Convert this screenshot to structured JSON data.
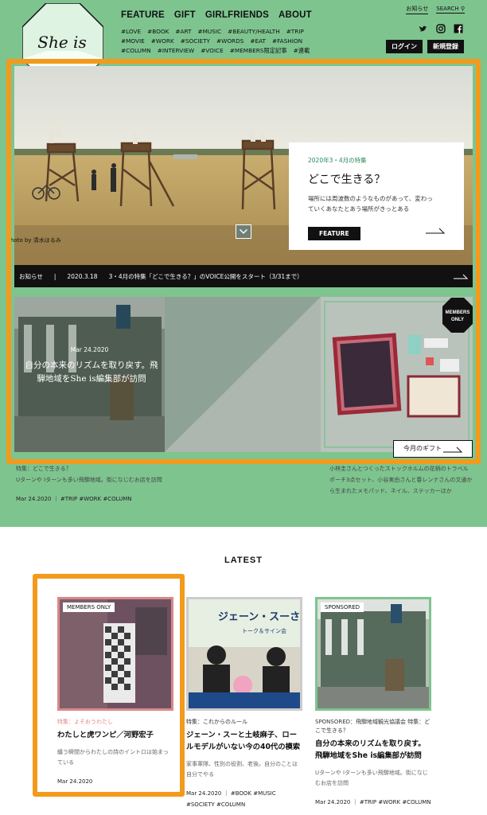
{
  "header": {
    "logo_text": "She is",
    "nav": [
      "FEATURE",
      "GIFT",
      "GIRLFRIENDS",
      "ABOUT"
    ],
    "tags": [
      "#LOVE",
      "#BOOK",
      "#ART",
      "#MUSIC",
      "#BEAUTY/HEALTH",
      "#TRIP",
      "#MOVIE",
      "#WORK",
      "#SOCIETY",
      "#WORDS",
      "#EAT",
      "#FASHION",
      "#COLUMN",
      "#INTERVIEW",
      "#VOICE",
      "#MEMBERS限定記事",
      "#連載"
    ],
    "about_link": "お知らせ",
    "search_label": "SEARCH",
    "login_label": "ログイン",
    "register_label": "新規登録",
    "social_icons": [
      "twitter-icon",
      "instagram-icon",
      "facebook-icon"
    ]
  },
  "hero": {
    "photo_credit": "hoto by 清水はるみ",
    "date": "2020年3・4月の特集",
    "title": "どこで生きる？",
    "desc_line1": "場所には周波数のようなものがあって、変わっ",
    "desc_line2": "ていくあなたとあう場所がきっとある",
    "button_label": "FEATURE"
  },
  "news": {
    "label": "お知らせ",
    "separator": "|",
    "date": "2020.3.18",
    "text": "3・4月の特集「どこで生きる？」のVOICE公開をスタート（3/31まで）"
  },
  "sub_left": {
    "date": "Mar 24.2020",
    "title": "自分の本来のリズムを取り戻す。飛騨地域をShe is編集部が訪問"
  },
  "sub_right": {
    "badge_line1": "MEMBERS",
    "badge_line2": "ONLY",
    "gift_button": "今月のギフト"
  },
  "below_left": {
    "category": "特集：どこで生きる？",
    "desc": "Uターンや Iターンも多い飛騨地域。街になじむお店を訪問",
    "meta": "Mar 24.2020 ｜ #TRIP #WORK #COLUMN"
  },
  "below_right": {
    "desc": "小林圭さんとつくったストックホルムの花柄のトラベルポーチ3点セット、小谷実由さんと春レンナさんの文通から生まれたメモパッド、ネイル、ステッカーほか"
  },
  "latest": {
    "heading": "LATEST",
    "cards": [
      {
        "badge": "MEMBERS ONLY",
        "category": "特集：よそおうわたし",
        "title": "わたしと虎ワンピ／河野宏子",
        "desc": "纏う瞬間からわたしの詩のイントロは始まっている",
        "meta": "Mar 24.2020"
      },
      {
        "badge": "",
        "category": "特集：これからのルール",
        "title": "ジェーン・スーと土岐麻子、ロールモデルがいない今の40代の模索",
        "desc": "家事軍隊、性別の役割、老後。自分のことは自分でやる",
        "meta": "Mar 24.2020 ｜ #BOOK #MUSIC #SOCIETY #COLUMN",
        "poster_text": "ジェーン・スーさん",
        "poster_sub": "トーク＆サイン会"
      },
      {
        "badge": "SPONSORED",
        "category": "SPONSORED：飛騨地域観光協議会 特集：どこで生きる？",
        "title": "自分の本来のリズムを取り戻す。飛騨地域をShe is編集部が訪問",
        "desc": "Uターンや Iターンも多い飛騨地域。街になじむお店を訪問",
        "meta": "Mar 24.2020 ｜ #TRIP #WORK #COLUMN"
      }
    ]
  },
  "colors": {
    "brand_green": "#7ec48f",
    "highlight_orange": "#f39a1c",
    "card1_border": "#d9888a",
    "card2_border": "#cccccc",
    "card3_border": "#7ec48f"
  }
}
